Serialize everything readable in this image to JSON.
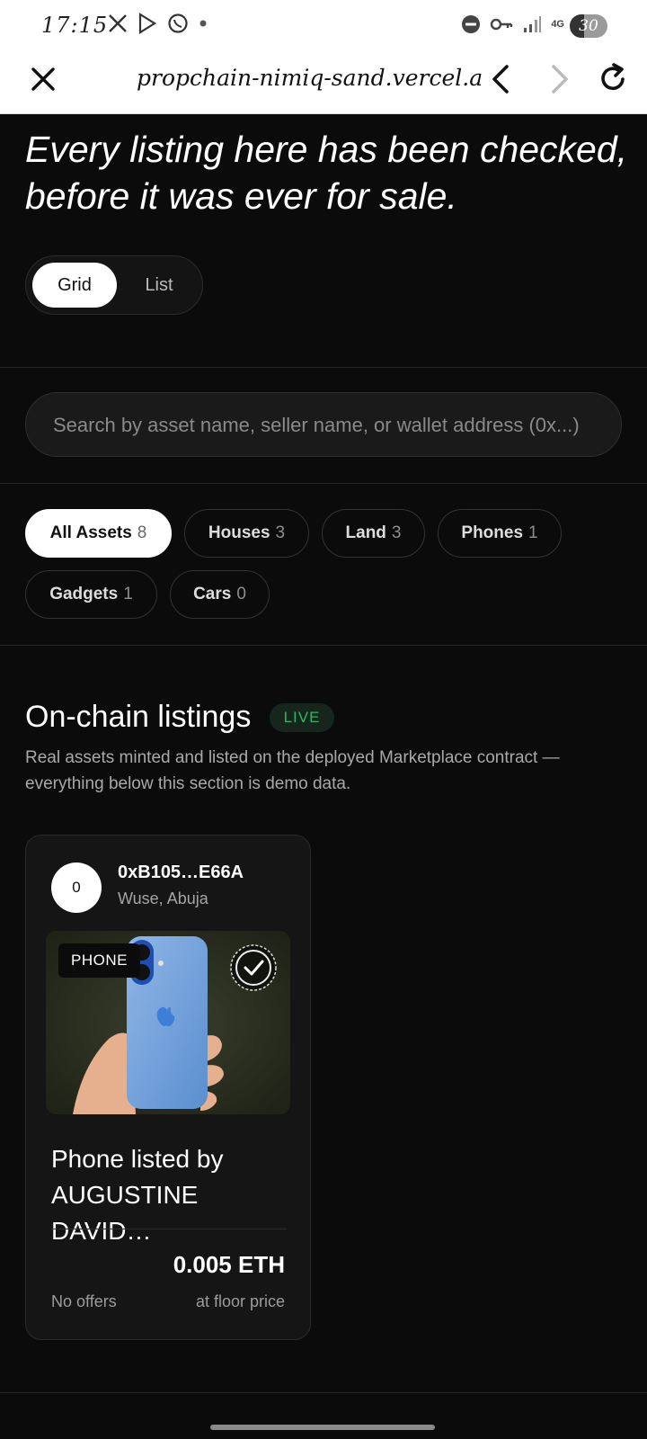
{
  "status_bar": {
    "time": "17:15",
    "battery": "30",
    "network": "4G",
    "icons": [
      "x-icon",
      "play-store-icon",
      "whatsapp-icon",
      "dot-icon",
      "dnd-icon",
      "key-icon",
      "signal-icon",
      "signal-icon"
    ]
  },
  "browser": {
    "url": "propchain-nimiq-sand.vercel.app",
    "icons": [
      "close-icon",
      "back-icon",
      "forward-icon",
      "reload-icon"
    ]
  },
  "hero": {
    "headline": "Every listing here has been checked, before it was ever for sale."
  },
  "view_toggle": {
    "options": [
      "Grid",
      "List"
    ],
    "selected": "Grid"
  },
  "search": {
    "placeholder": "Search by asset name, seller name, or wallet address (0x...)"
  },
  "filters": [
    {
      "label": "All Assets",
      "count": "8",
      "active": true
    },
    {
      "label": "Houses",
      "count": "3",
      "active": false
    },
    {
      "label": "Land",
      "count": "3",
      "active": false
    },
    {
      "label": "Phones",
      "count": "1",
      "active": false
    },
    {
      "label": "Gadgets",
      "count": "1",
      "active": false
    },
    {
      "label": "Cars",
      "count": "0",
      "active": false
    }
  ],
  "onchain": {
    "title": "On-chain listings",
    "badge": "LIVE",
    "description": "Real assets minted and listed on the deployed Marketplace contract — everything below this section is demo data."
  },
  "listing": {
    "avatar_text": "0",
    "seller_address": "0xB105…E66A",
    "seller_location": "Wuse, Abuja",
    "category_tag": "PHONE",
    "name": "Phone listed by AUGUSTINE DAVID…",
    "price": "0.005 ETH",
    "offers": "No offers",
    "price_note": "at floor price"
  },
  "colors": {
    "background": "#0b0b0b",
    "live_green": "#2fb56a",
    "card_bg": "#151515"
  }
}
